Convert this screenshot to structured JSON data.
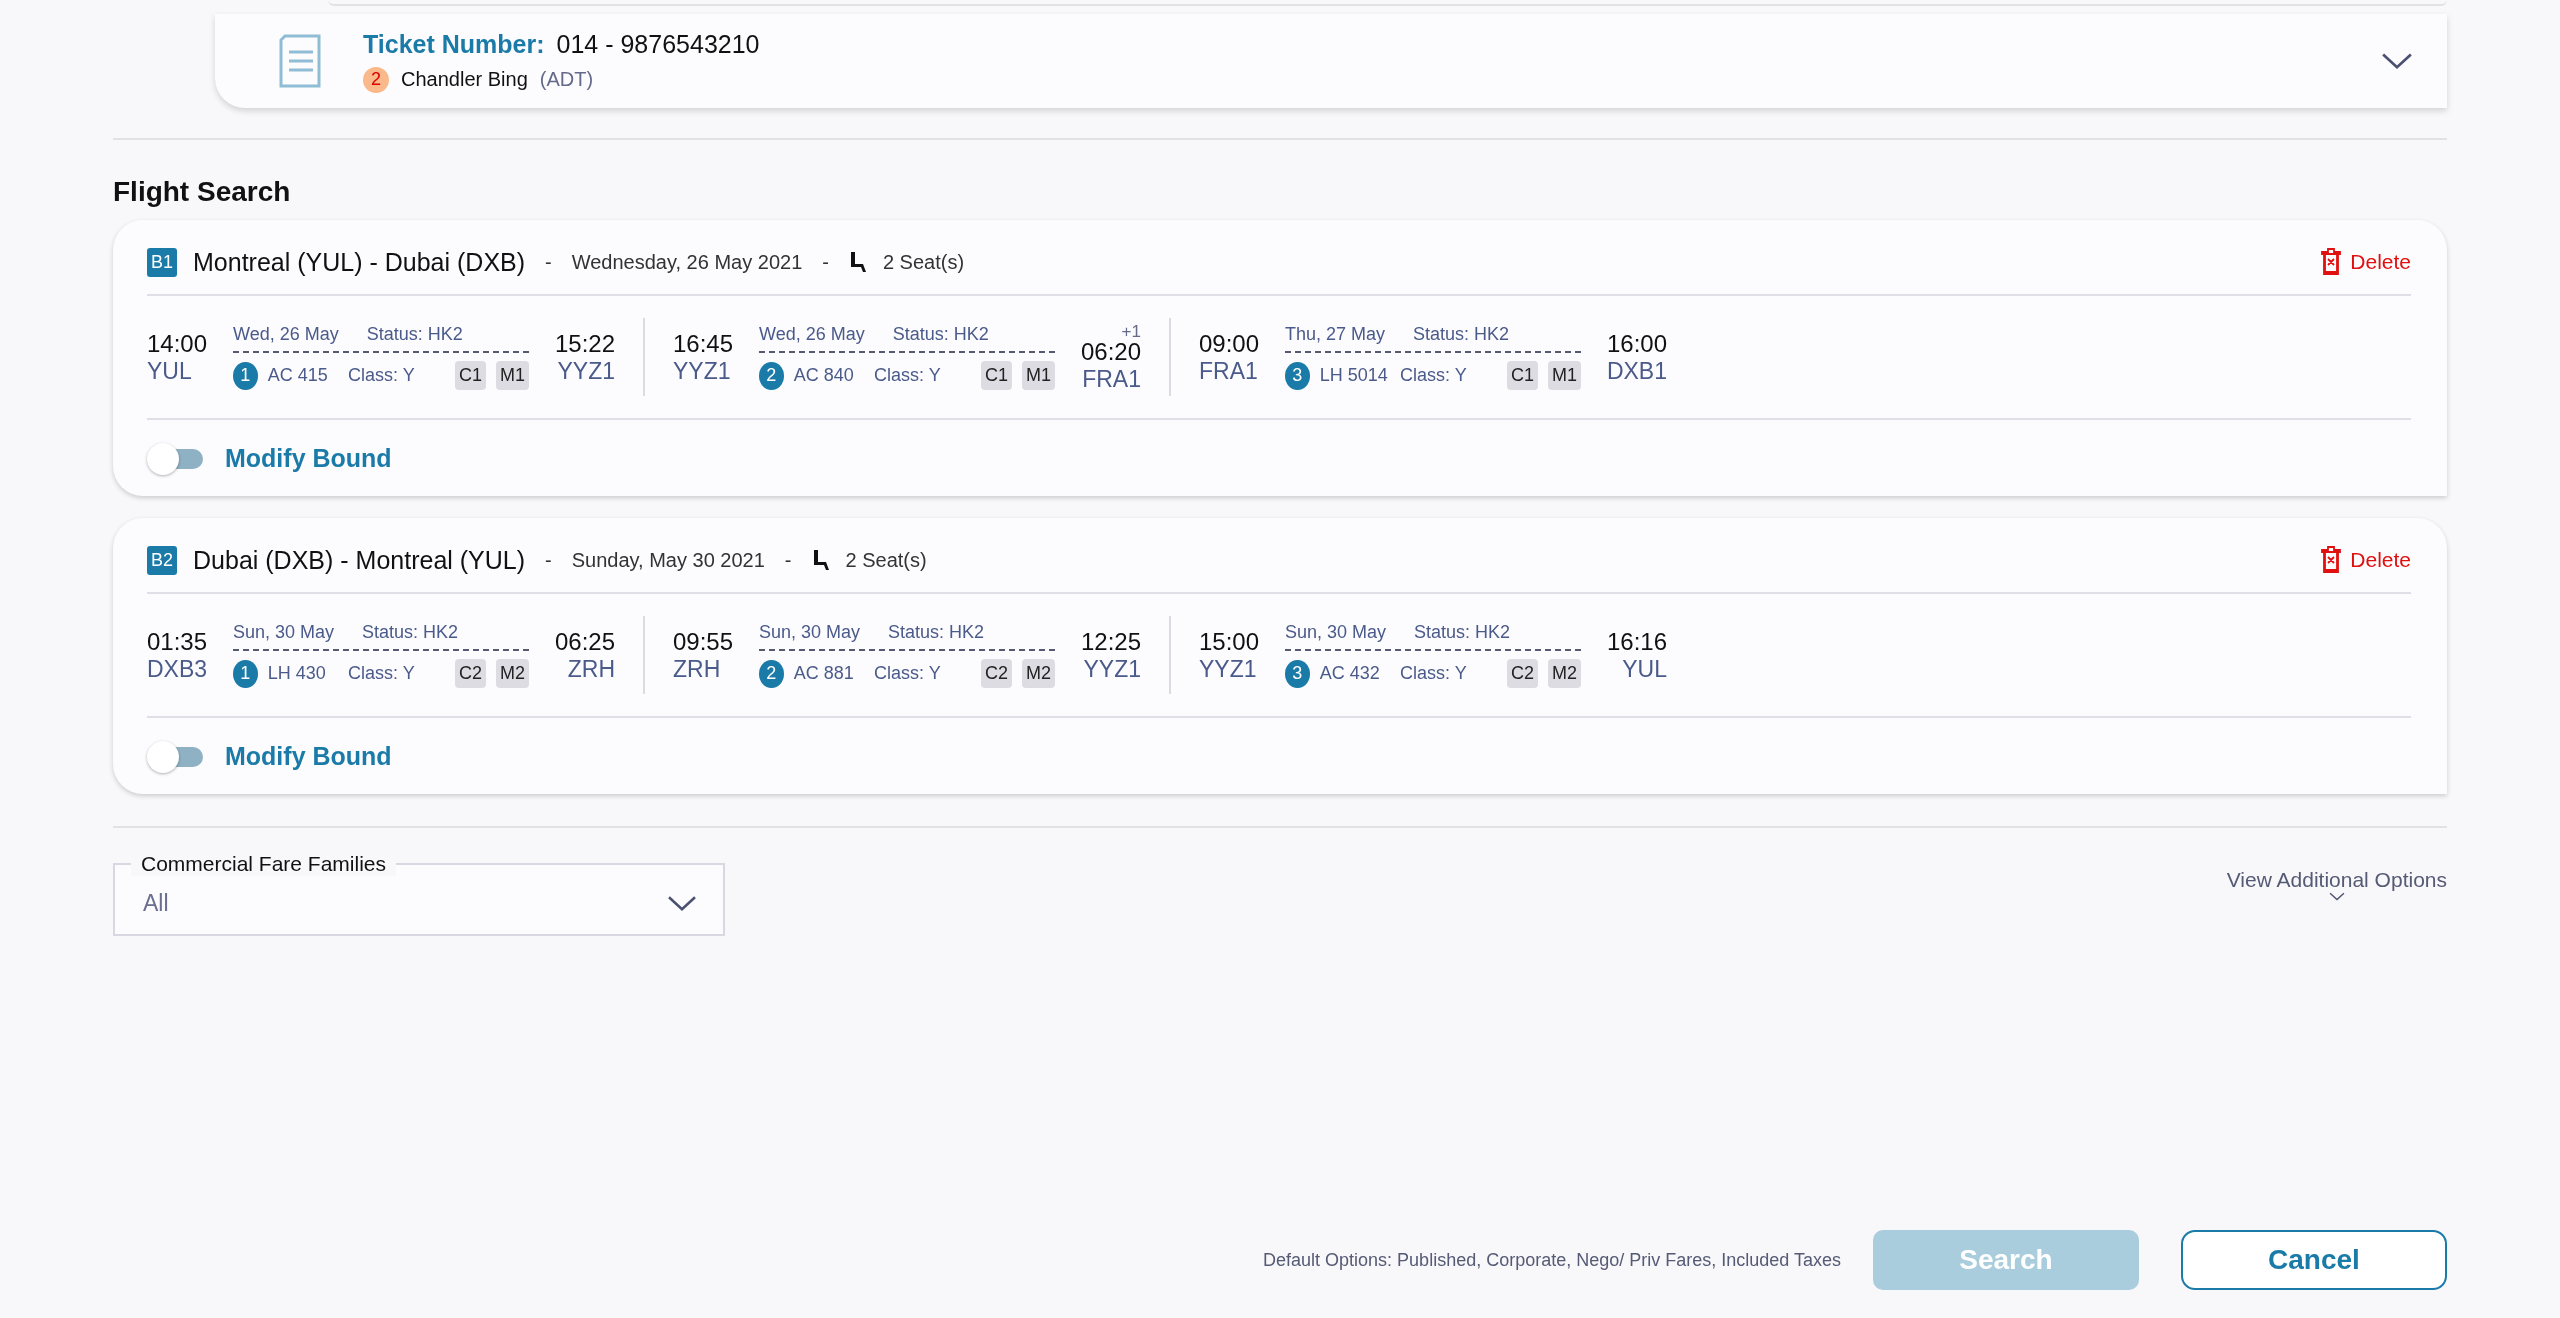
{
  "ticket": {
    "label": "Ticket Number:",
    "number": "014 - 9876543210",
    "passenger_index": "2",
    "passenger_name": "Chandler Bing",
    "passenger_type": "(ADT)",
    "expanded": false
  },
  "section_title": "Flight Search",
  "bounds": [
    {
      "badge": "B1",
      "route": "Montreal (YUL) - Dubai (DXB)",
      "separator": "-",
      "date": "Wednesday, 26 May 2021",
      "seats": "2 Seat(s)",
      "delete_label": "Delete",
      "toggle": {
        "label": "Modify Bound",
        "on": false
      },
      "segments": [
        {
          "dep_time": "14:00",
          "dep_airport": "YUL",
          "date": "Wed, 26 May",
          "status": "Status: HK2",
          "index": "1",
          "flight": "AC 415",
          "class": "Class: Y",
          "tags": [
            "C1",
            "M1"
          ],
          "arr_time": "15:22",
          "arr_airport": "YYZ1"
        },
        {
          "dep_time": "16:45",
          "dep_airport": "YYZ1",
          "date": "Wed, 26 May",
          "status": "Status: HK2",
          "index": "2",
          "flight": "AC 840",
          "class": "Class: Y",
          "tags": [
            "C1",
            "M1"
          ],
          "arr_time": "06:20",
          "arr_airport": "FRA1",
          "day_offset": "+1"
        },
        {
          "dep_time": "09:00",
          "dep_airport": "FRA1",
          "date": "Thu, 27 May",
          "status": "Status: HK2",
          "index": "3",
          "flight": "LH 5014",
          "class": "Class: Y",
          "tags": [
            "C1",
            "M1"
          ],
          "arr_time": "16:00",
          "arr_airport": "DXB1"
        }
      ]
    },
    {
      "badge": "B2",
      "route": "Dubai (DXB) - Montreal (YUL)",
      "separator": "-",
      "date": "Sunday, May 30 2021",
      "seats": "2 Seat(s)",
      "delete_label": "Delete",
      "toggle": {
        "label": "Modify Bound",
        "on": false
      },
      "segments": [
        {
          "dep_time": "01:35",
          "dep_airport": "DXB3",
          "date": "Sun, 30 May",
          "status": "Status: HK2",
          "index": "1",
          "flight": "LH 430",
          "class": "Class: Y",
          "tags": [
            "C2",
            "M2"
          ],
          "arr_time": "06:25",
          "arr_airport": "ZRH"
        },
        {
          "dep_time": "09:55",
          "dep_airport": "ZRH",
          "date": "Sun, 30 May",
          "status": "Status: HK2",
          "index": "2",
          "flight": "AC 881",
          "class": "Class: Y",
          "tags": [
            "C2",
            "M2"
          ],
          "arr_time": "12:25",
          "arr_airport": "YYZ1"
        },
        {
          "dep_time": "15:00",
          "dep_airport": "YYZ1",
          "date": "Sun, 30 May",
          "status": "Status: HK2",
          "index": "3",
          "flight": "AC 432",
          "class": "Class: Y",
          "tags": [
            "C2",
            "M2"
          ],
          "arr_time": "16:16",
          "arr_airport": "YUL"
        }
      ]
    }
  ],
  "fare_families": {
    "label": "Commercial Fare Families",
    "value": "All"
  },
  "additional_options": "View Additional Options",
  "footer": {
    "note": "Default Options: Published, Corporate, Nego/ Priv Fares, Included Taxes",
    "search": {
      "label": "Search",
      "disabled": true
    },
    "cancel": "Cancel"
  }
}
